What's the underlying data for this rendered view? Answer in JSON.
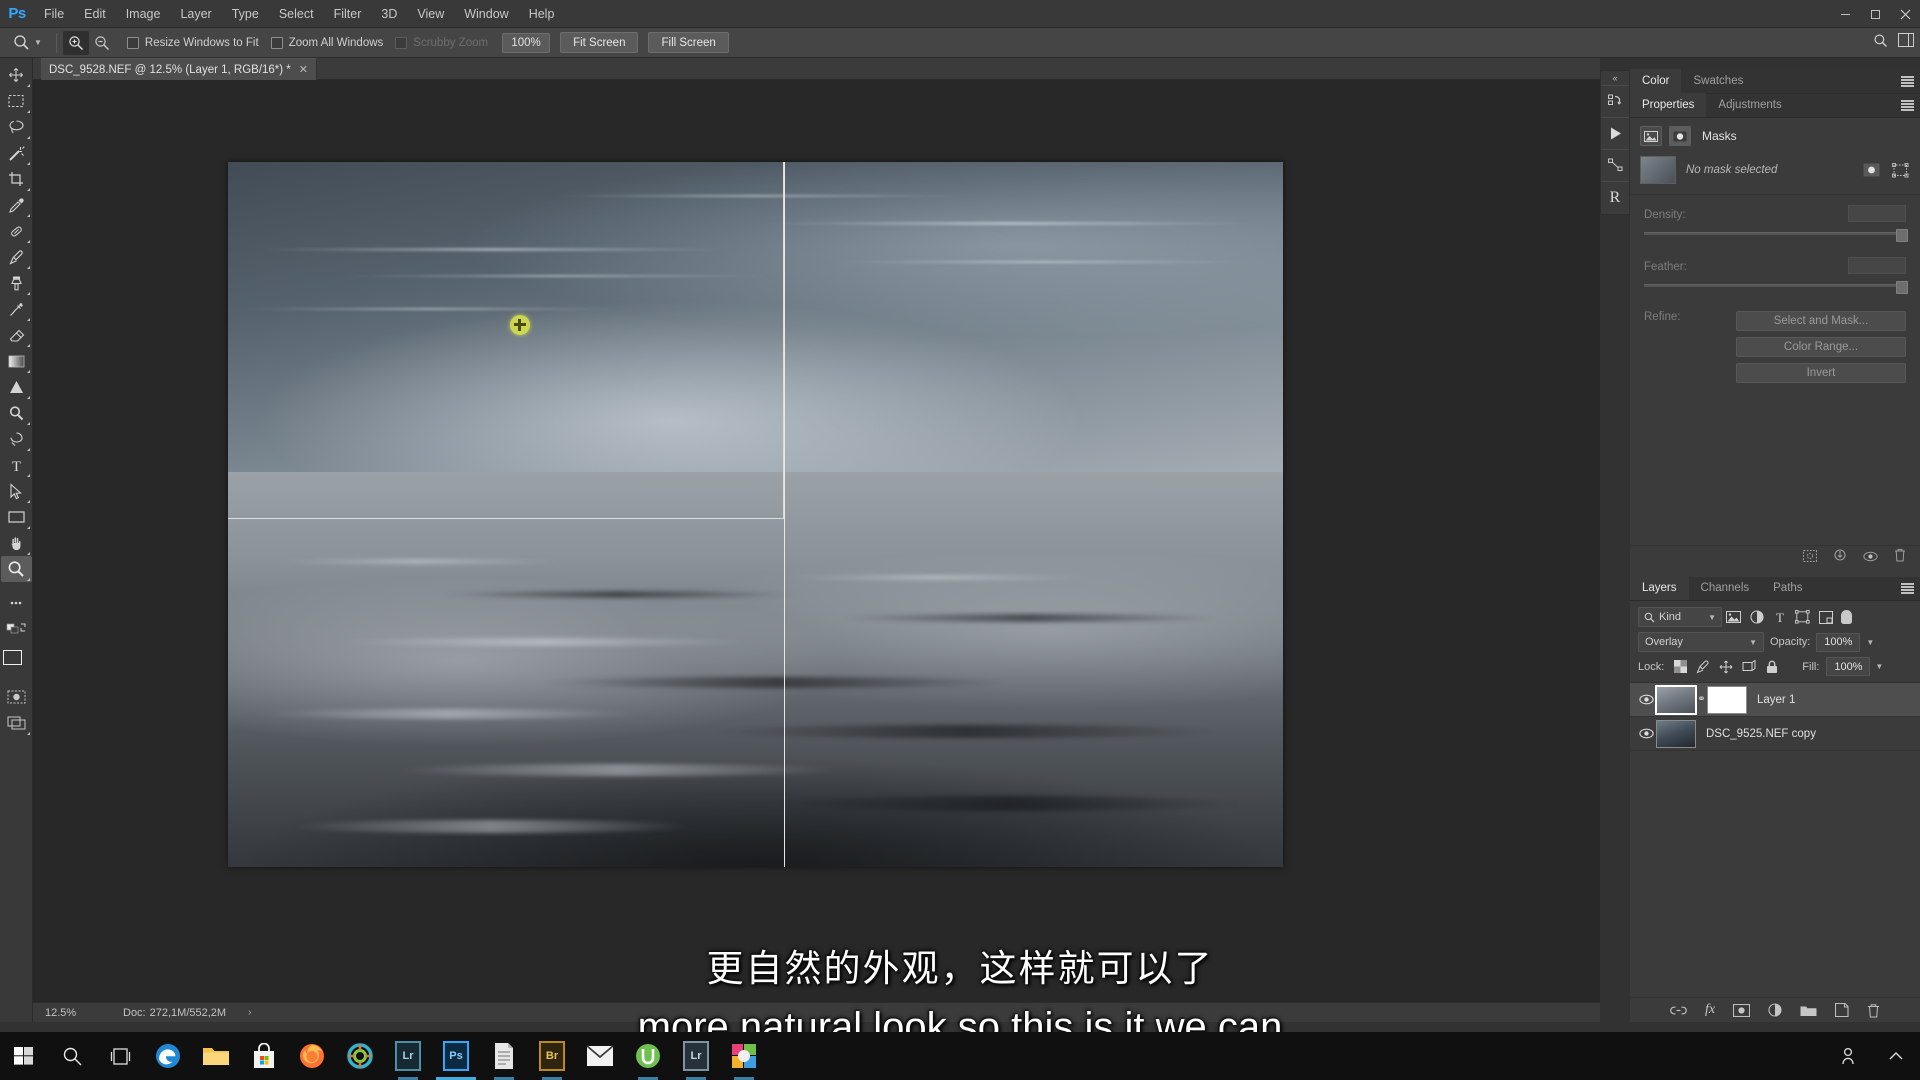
{
  "app": {
    "name": "Adobe Photoshop",
    "logo_text": "Ps",
    "accent": "#31a8ff"
  },
  "menubar": {
    "items": [
      {
        "label": "File"
      },
      {
        "label": "Edit"
      },
      {
        "label": "Image"
      },
      {
        "label": "Layer"
      },
      {
        "label": "Type"
      },
      {
        "label": "Select"
      },
      {
        "label": "Filter"
      },
      {
        "label": "3D"
      },
      {
        "label": "View"
      },
      {
        "label": "Window"
      },
      {
        "label": "Help"
      }
    ],
    "window_controls": {
      "minimize": "—",
      "maximize": "□",
      "close": "✕"
    }
  },
  "options_bar": {
    "tool": "zoom-tool",
    "zoom_in_label": "Zoom In",
    "zoom_out_label": "Zoom Out",
    "resize_windows_label": "Resize Windows to Fit",
    "zoom_all_label": "Zoom All Windows",
    "scrubby_label": "Scrubby Zoom",
    "zoom_value": "100%",
    "fit_screen_label": "Fit Screen",
    "fill_screen_label": "Fill Screen"
  },
  "toolbar": {
    "tools": [
      {
        "name": "move-tool"
      },
      {
        "name": "rectangular-marquee-tool"
      },
      {
        "name": "lasso-tool"
      },
      {
        "name": "magic-wand-tool"
      },
      {
        "name": "crop-tool"
      },
      {
        "name": "eyedropper-tool"
      },
      {
        "name": "spot-healing-brush-tool"
      },
      {
        "name": "brush-tool"
      },
      {
        "name": "clone-stamp-tool"
      },
      {
        "name": "history-brush-tool"
      },
      {
        "name": "eraser-tool"
      },
      {
        "name": "gradient-tool"
      },
      {
        "name": "blur-tool"
      },
      {
        "name": "dodge-tool"
      },
      {
        "name": "pen-tool"
      },
      {
        "name": "horizontal-type-tool"
      },
      {
        "name": "path-selection-tool"
      },
      {
        "name": "rectangle-tool"
      },
      {
        "name": "hand-tool"
      },
      {
        "name": "zoom-tool"
      }
    ],
    "more_label": "•••",
    "foreground_color": "#3a3a3a",
    "background_color": "#29b6e8"
  },
  "document": {
    "tab_title": "DSC_9528.NEF @ 12.5% (Layer 1, RGB/16*) *",
    "close_glyph": "✕"
  },
  "status_bar": {
    "zoom": "12.5%",
    "doc_label": "Doc:",
    "doc_size": "272,1M/552,2M",
    "arrow": "›"
  },
  "rail": {
    "collapse_glyph": "«",
    "items": [
      {
        "name": "history-panel-icon"
      },
      {
        "name": "actions-panel-icon"
      },
      {
        "name": "paths-panel-icon"
      },
      {
        "name": "camera-raw-filter-icon",
        "label": "R"
      }
    ]
  },
  "color_panel": {
    "tabs": [
      {
        "label": "Color",
        "active": true
      },
      {
        "label": "Swatches",
        "active": false
      }
    ]
  },
  "properties_panel": {
    "tabs": [
      {
        "label": "Properties",
        "active": true
      },
      {
        "label": "Adjustments",
        "active": false
      }
    ],
    "title": "Masks",
    "mask_status": "No mask selected",
    "density_label": "Density:",
    "density_value": "",
    "feather_label": "Feather:",
    "feather_value": "",
    "refine_label": "Refine:",
    "select_and_mask_label": "Select and Mask...",
    "color_range_label": "Color Range...",
    "invert_label": "Invert",
    "footer_icons": [
      {
        "name": "load-selection-icon"
      },
      {
        "name": "apply-mask-icon"
      },
      {
        "name": "toggle-mask-icon"
      },
      {
        "name": "delete-mask-icon"
      }
    ]
  },
  "layers_panel": {
    "tabs": [
      {
        "label": "Layers",
        "active": true
      },
      {
        "label": "Channels",
        "active": false
      },
      {
        "label": "Paths",
        "active": false
      }
    ],
    "filter_kind": "Kind",
    "filter_icons": [
      {
        "name": "filter-pixel-icon"
      },
      {
        "name": "filter-adjustment-icon"
      },
      {
        "name": "filter-type-icon"
      },
      {
        "name": "filter-shape-icon"
      },
      {
        "name": "filter-smart-object-icon"
      }
    ],
    "blend_mode": "Overlay",
    "opacity_label": "Opacity:",
    "opacity_value": "100%",
    "lock_label": "Lock:",
    "lock_icons": [
      {
        "name": "lock-transparent-pixels-icon"
      },
      {
        "name": "lock-image-pixels-icon"
      },
      {
        "name": "lock-position-icon"
      },
      {
        "name": "lock-artboard-nesting-icon"
      },
      {
        "name": "lock-all-icon"
      }
    ],
    "fill_label": "Fill:",
    "fill_value": "100%",
    "layers": [
      {
        "name": "Layer 1",
        "visible": true,
        "selected": true,
        "has_mask": true
      },
      {
        "name": "DSC_9525.NEF copy",
        "visible": true,
        "selected": false,
        "has_mask": false
      }
    ],
    "footer_icons": [
      {
        "name": "link-layers-icon"
      },
      {
        "name": "layer-style-fx-icon",
        "label": "fx"
      },
      {
        "name": "add-layer-mask-icon"
      },
      {
        "name": "new-adjustment-layer-icon"
      },
      {
        "name": "new-group-icon"
      },
      {
        "name": "new-layer-icon"
      },
      {
        "name": "delete-layer-icon"
      }
    ]
  },
  "canvas": {
    "zoom_percent": "12.5%",
    "cursor_name": "brush-cursor"
  },
  "subtitles": {
    "chinese": "更自然的外观，这样就可以了",
    "english": "more natural look so this is it we can"
  },
  "taskbar": {
    "items": [
      {
        "name": "start-button"
      },
      {
        "name": "search-button"
      },
      {
        "name": "task-view-button"
      },
      {
        "name": "edge-app",
        "label": "e"
      },
      {
        "name": "file-explorer-app"
      },
      {
        "name": "microsoft-store-app"
      },
      {
        "name": "firefox-app"
      },
      {
        "name": "settings-app"
      },
      {
        "name": "lightroom-app",
        "label": "Lr"
      },
      {
        "name": "photoshop-app",
        "label": "Ps"
      },
      {
        "name": "document-app"
      },
      {
        "name": "bridge-app",
        "label": "Br"
      },
      {
        "name": "mail-app"
      },
      {
        "name": "green-app"
      },
      {
        "name": "lightroom-classic-app",
        "label": "Lr"
      },
      {
        "name": "colorful-app"
      }
    ],
    "system_icons": [
      {
        "name": "people-icon"
      },
      {
        "name": "show-hidden-icons-chevron"
      }
    ]
  }
}
